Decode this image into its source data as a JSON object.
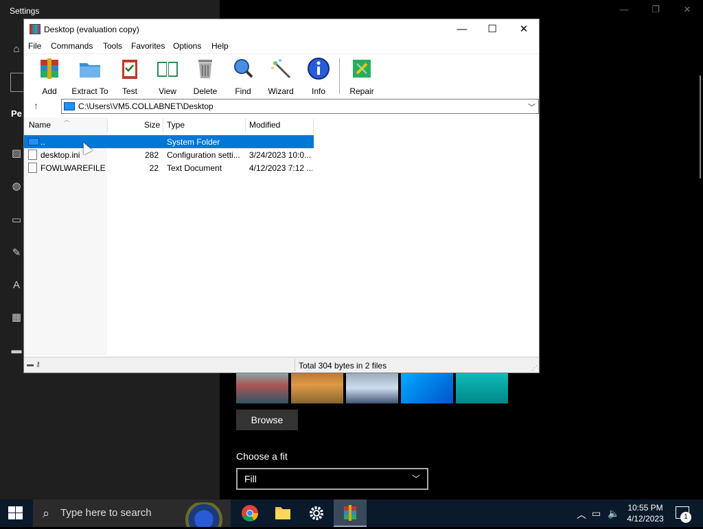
{
  "settings": {
    "title": "Settings",
    "section_partial": "Pe",
    "browse_label": "Browse",
    "fit_label": "Choose a fit",
    "fit_value": "Fill",
    "controls": {
      "minimize": "—",
      "restore": "❐",
      "close": "✕"
    }
  },
  "rar": {
    "title": "Desktop (evaluation copy)",
    "controls": {
      "minimize": "—",
      "maximize": "☐",
      "close": "✕"
    },
    "menu": [
      "File",
      "Commands",
      "Tools",
      "Favorites",
      "Options",
      "Help"
    ],
    "toolbar": [
      {
        "label": "Add",
        "icon": "add-archive-icon"
      },
      {
        "label": "Extract To",
        "icon": "extract-folder-icon"
      },
      {
        "label": "Test",
        "icon": "test-clipboard-icon"
      },
      {
        "label": "View",
        "icon": "view-book-icon"
      },
      {
        "label": "Delete",
        "icon": "trash-icon"
      },
      {
        "label": "Find",
        "icon": "magnifier-icon"
      },
      {
        "label": "Wizard",
        "icon": "magic-wand-icon"
      },
      {
        "label": "Info",
        "icon": "info-icon"
      },
      {
        "label": "Repair",
        "icon": "repair-kit-icon"
      }
    ],
    "up_glyph": "↑",
    "address": "C:\\Users\\VM5.COLLABNET\\Desktop",
    "columns": [
      "Name",
      "Size",
      "Type",
      "Modified"
    ],
    "rows": [
      {
        "name": "..",
        "size": "",
        "type": "System Folder",
        "modified": "",
        "selected": true
      },
      {
        "name": "desktop.ini",
        "size": "282",
        "type": "Configuration setti...",
        "modified": "3/24/2023 10:0...",
        "selected": false
      },
      {
        "name": "FOWLWAREFILE...",
        "size": "22",
        "type": "Text Document",
        "modified": "4/12/2023 7:12 ...",
        "selected": false
      }
    ],
    "status": "Total 304 bytes in 2 files"
  },
  "taskbar": {
    "search_placeholder": "Type here to search",
    "apps": [
      "chrome-icon",
      "file-explorer-icon",
      "settings-gear-icon",
      "winrar-icon"
    ],
    "time": "10:55 PM",
    "date": "4/12/2023",
    "notification_count": "1"
  }
}
